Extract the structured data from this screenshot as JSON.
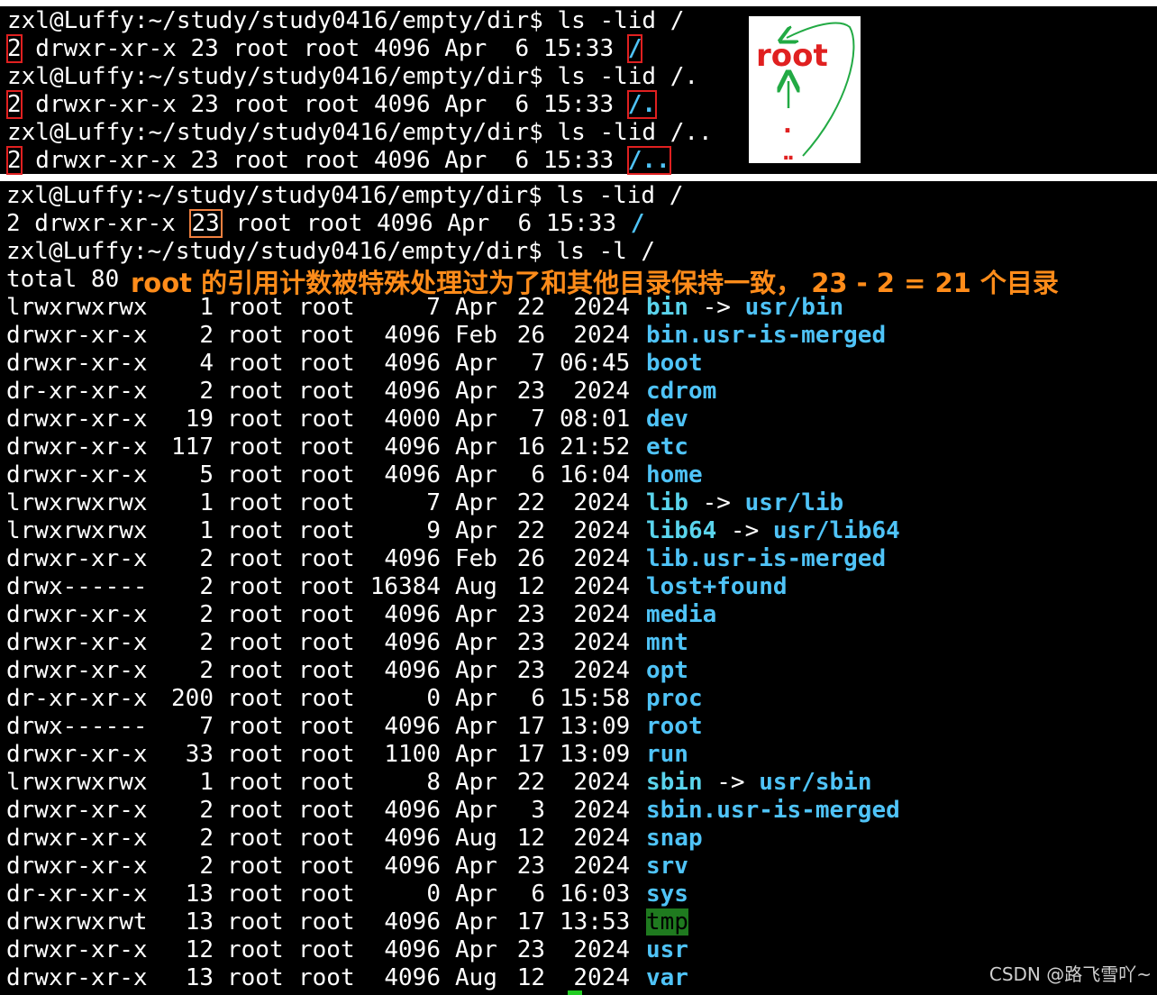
{
  "top_terminal": {
    "lines": [
      {
        "prompt": "zxl@Luffy:~/study/study0416/empty/dir$ ls -lid /"
      },
      {
        "links": "2",
        "rest": " drwxr-xr-x 23 root root 4096 Apr  6 15:33 ",
        "path": "/"
      },
      {
        "prompt": "zxl@Luffy:~/study/study0416/empty/dir$ ls -lid /."
      },
      {
        "links": "2",
        "rest": " drwxr-xr-x 23 root root 4096 Apr  6 15:33 ",
        "path": "/."
      },
      {
        "prompt": "zxl@Luffy:~/study/study0416/empty/dir$ ls -lid /.."
      },
      {
        "links": "2",
        "rest": " drwxr-xr-x 23 root root 4096 Apr  6 15:33 ",
        "path": "/.."
      }
    ],
    "diagram": {
      "root": "root",
      "dot": ".",
      "dotdot": ".."
    }
  },
  "bottom_terminal": {
    "prompt1": "zxl@Luffy:~/study/study0416/empty/dir$ ls -lid /",
    "lid_a": "2 drwxr-xr-x ",
    "lid_count": "23",
    "lid_b": " root root 4096 Apr  6 15:33 ",
    "lid_path": "/",
    "prompt2": "zxl@Luffy:~/study/study0416/empty/dir$ ls -l /",
    "total": "total 80",
    "annotation": "root 的引用计数被特殊处理过为了和其他目录保持一致， 23 - 2 = 21 个目录",
    "entries": [
      {
        "perm": "lrwxrwxrwx",
        "links": "1",
        "user": "root",
        "group": "root",
        "size": "7",
        "month": "Apr",
        "day": "22",
        "time": "2024",
        "name": "bin",
        "arrow": " -> ",
        "target": "usr/bin",
        "style": "cyan"
      },
      {
        "perm": "drwxr-xr-x",
        "links": "2",
        "user": "root",
        "group": "root",
        "size": "4096",
        "month": "Feb",
        "day": "26",
        "time": "2024",
        "name": "bin.usr-is-merged",
        "style": "blue"
      },
      {
        "perm": "drwxr-xr-x",
        "links": "4",
        "user": "root",
        "group": "root",
        "size": "4096",
        "month": "Apr",
        "day": "7",
        "time": "06:45",
        "name": "boot",
        "style": "blue"
      },
      {
        "perm": "dr-xr-xr-x",
        "links": "2",
        "user": "root",
        "group": "root",
        "size": "4096",
        "month": "Apr",
        "day": "23",
        "time": "2024",
        "name": "cdrom",
        "style": "blue"
      },
      {
        "perm": "drwxr-xr-x",
        "links": "19",
        "user": "root",
        "group": "root",
        "size": "4000",
        "month": "Apr",
        "day": "7",
        "time": "08:01",
        "name": "dev",
        "style": "blue"
      },
      {
        "perm": "drwxr-xr-x",
        "links": "117",
        "user": "root",
        "group": "root",
        "size": "4096",
        "month": "Apr",
        "day": "16",
        "time": "21:52",
        "name": "etc",
        "style": "blue"
      },
      {
        "perm": "drwxr-xr-x",
        "links": "5",
        "user": "root",
        "group": "root",
        "size": "4096",
        "month": "Apr",
        "day": "6",
        "time": "16:04",
        "name": "home",
        "style": "blue"
      },
      {
        "perm": "lrwxrwxrwx",
        "links": "1",
        "user": "root",
        "group": "root",
        "size": "7",
        "month": "Apr",
        "day": "22",
        "time": "2024",
        "name": "lib",
        "arrow": " -> ",
        "target": "usr/lib",
        "style": "cyan"
      },
      {
        "perm": "lrwxrwxrwx",
        "links": "1",
        "user": "root",
        "group": "root",
        "size": "9",
        "month": "Apr",
        "day": "22",
        "time": "2024",
        "name": "lib64",
        "arrow": " -> ",
        "target": "usr/lib64",
        "style": "cyan"
      },
      {
        "perm": "drwxr-xr-x",
        "links": "2",
        "user": "root",
        "group": "root",
        "size": "4096",
        "month": "Feb",
        "day": "26",
        "time": "2024",
        "name": "lib.usr-is-merged",
        "style": "blue"
      },
      {
        "perm": "drwx------",
        "links": "2",
        "user": "root",
        "group": "root",
        "size": "16384",
        "month": "Aug",
        "day": "12",
        "time": "2024",
        "name": "lost+found",
        "style": "blue"
      },
      {
        "perm": "drwxr-xr-x",
        "links": "2",
        "user": "root",
        "group": "root",
        "size": "4096",
        "month": "Apr",
        "day": "23",
        "time": "2024",
        "name": "media",
        "style": "blue"
      },
      {
        "perm": "drwxr-xr-x",
        "links": "2",
        "user": "root",
        "group": "root",
        "size": "4096",
        "month": "Apr",
        "day": "23",
        "time": "2024",
        "name": "mnt",
        "style": "blue"
      },
      {
        "perm": "drwxr-xr-x",
        "links": "2",
        "user": "root",
        "group": "root",
        "size": "4096",
        "month": "Apr",
        "day": "23",
        "time": "2024",
        "name": "opt",
        "style": "blue"
      },
      {
        "perm": "dr-xr-xr-x",
        "links": "200",
        "user": "root",
        "group": "root",
        "size": "0",
        "month": "Apr",
        "day": "6",
        "time": "15:58",
        "name": "proc",
        "style": "blue"
      },
      {
        "perm": "drwx------",
        "links": "7",
        "user": "root",
        "group": "root",
        "size": "4096",
        "month": "Apr",
        "day": "17",
        "time": "13:09",
        "name": "root",
        "style": "blue"
      },
      {
        "perm": "drwxr-xr-x",
        "links": "33",
        "user": "root",
        "group": "root",
        "size": "1100",
        "month": "Apr",
        "day": "17",
        "time": "13:09",
        "name": "run",
        "style": "blue"
      },
      {
        "perm": "lrwxrwxrwx",
        "links": "1",
        "user": "root",
        "group": "root",
        "size": "8",
        "month": "Apr",
        "day": "22",
        "time": "2024",
        "name": "sbin",
        "arrow": " -> ",
        "target": "usr/sbin",
        "style": "cyan"
      },
      {
        "perm": "drwxr-xr-x",
        "links": "2",
        "user": "root",
        "group": "root",
        "size": "4096",
        "month": "Apr",
        "day": "3",
        "time": "2024",
        "name": "sbin.usr-is-merged",
        "style": "blue"
      },
      {
        "perm": "drwxr-xr-x",
        "links": "2",
        "user": "root",
        "group": "root",
        "size": "4096",
        "month": "Aug",
        "day": "12",
        "time": "2024",
        "name": "snap",
        "style": "blue"
      },
      {
        "perm": "drwxr-xr-x",
        "links": "2",
        "user": "root",
        "group": "root",
        "size": "4096",
        "month": "Apr",
        "day": "23",
        "time": "2024",
        "name": "srv",
        "style": "blue"
      },
      {
        "perm": "dr-xr-xr-x",
        "links": "13",
        "user": "root",
        "group": "root",
        "size": "0",
        "month": "Apr",
        "day": "6",
        "time": "16:03",
        "name": "sys",
        "style": "blue"
      },
      {
        "perm": "drwxrwxrwt",
        "links": "13",
        "user": "root",
        "group": "root",
        "size": "4096",
        "month": "Apr",
        "day": "17",
        "time": "13:53",
        "name": "tmp",
        "style": "tmp"
      },
      {
        "perm": "drwxr-xr-x",
        "links": "12",
        "user": "root",
        "group": "root",
        "size": "4096",
        "month": "Apr",
        "day": "23",
        "time": "2024",
        "name": "usr",
        "style": "blue"
      },
      {
        "perm": "drwxr-xr-x",
        "links": "13",
        "user": "root",
        "group": "root",
        "size": "4096",
        "month": "Aug",
        "day": "12",
        "time": "2024",
        "name": "var",
        "style": "blue"
      }
    ]
  },
  "watermark": "CSDN @路飞雪吖~",
  "colors": {
    "terminal_bg": "#000000",
    "text": "#ffffff",
    "dir_blue": "#4fc3f7",
    "link_cyan": "#5ad4ec",
    "highlight_red": "#e02020",
    "annotation_orange": "#ff8c1a",
    "arrow_green": "#22aa44",
    "tmp_bg": "#1f7a1f"
  }
}
